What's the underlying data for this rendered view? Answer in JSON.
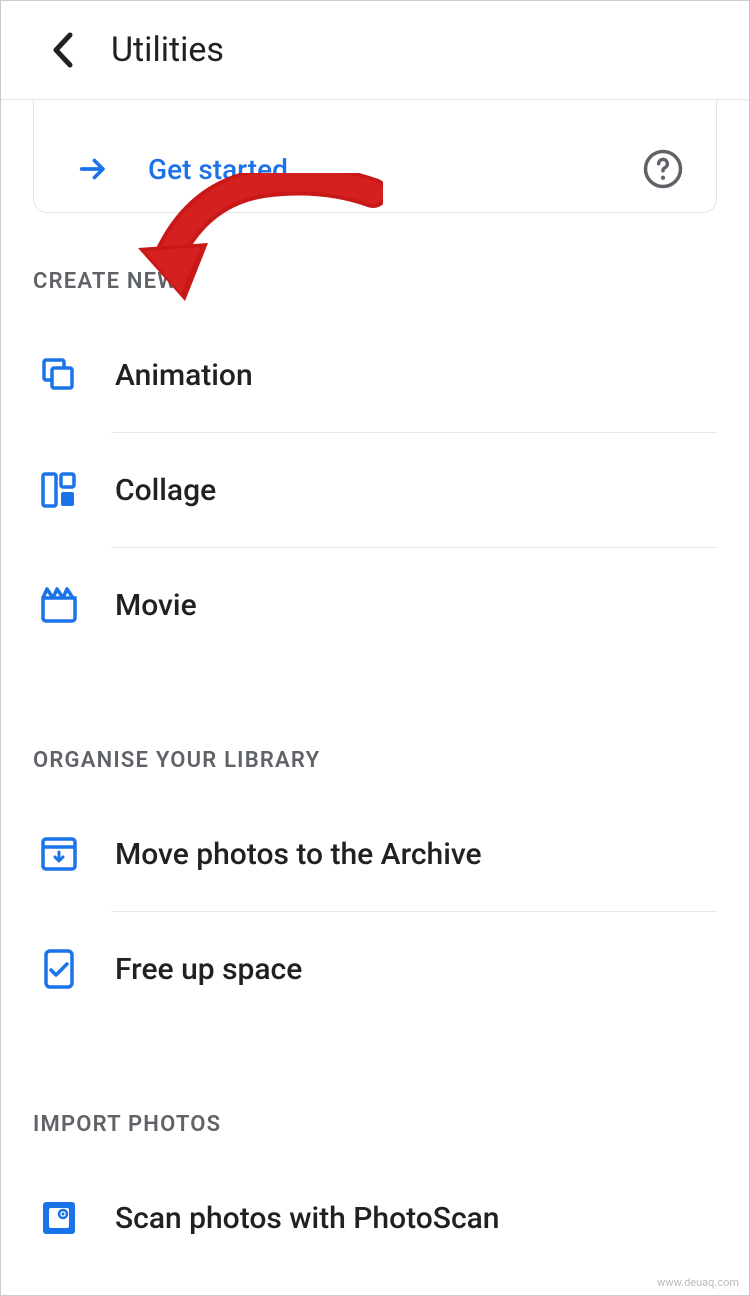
{
  "header": {
    "title": "Utilities"
  },
  "card": {
    "linkText": "Get started"
  },
  "sections": {
    "createNew": {
      "header": "CREATE NEW",
      "items": [
        {
          "label": "Animation"
        },
        {
          "label": "Collage"
        },
        {
          "label": "Movie"
        }
      ]
    },
    "organise": {
      "header": "ORGANISE YOUR LIBRARY",
      "items": [
        {
          "label": "Move photos to the Archive"
        },
        {
          "label": "Free up space"
        }
      ]
    },
    "import": {
      "header": "IMPORT PHOTOS",
      "items": [
        {
          "label": "Scan photos with PhotoScan"
        }
      ]
    }
  },
  "watermark": "www.deuaq.com"
}
